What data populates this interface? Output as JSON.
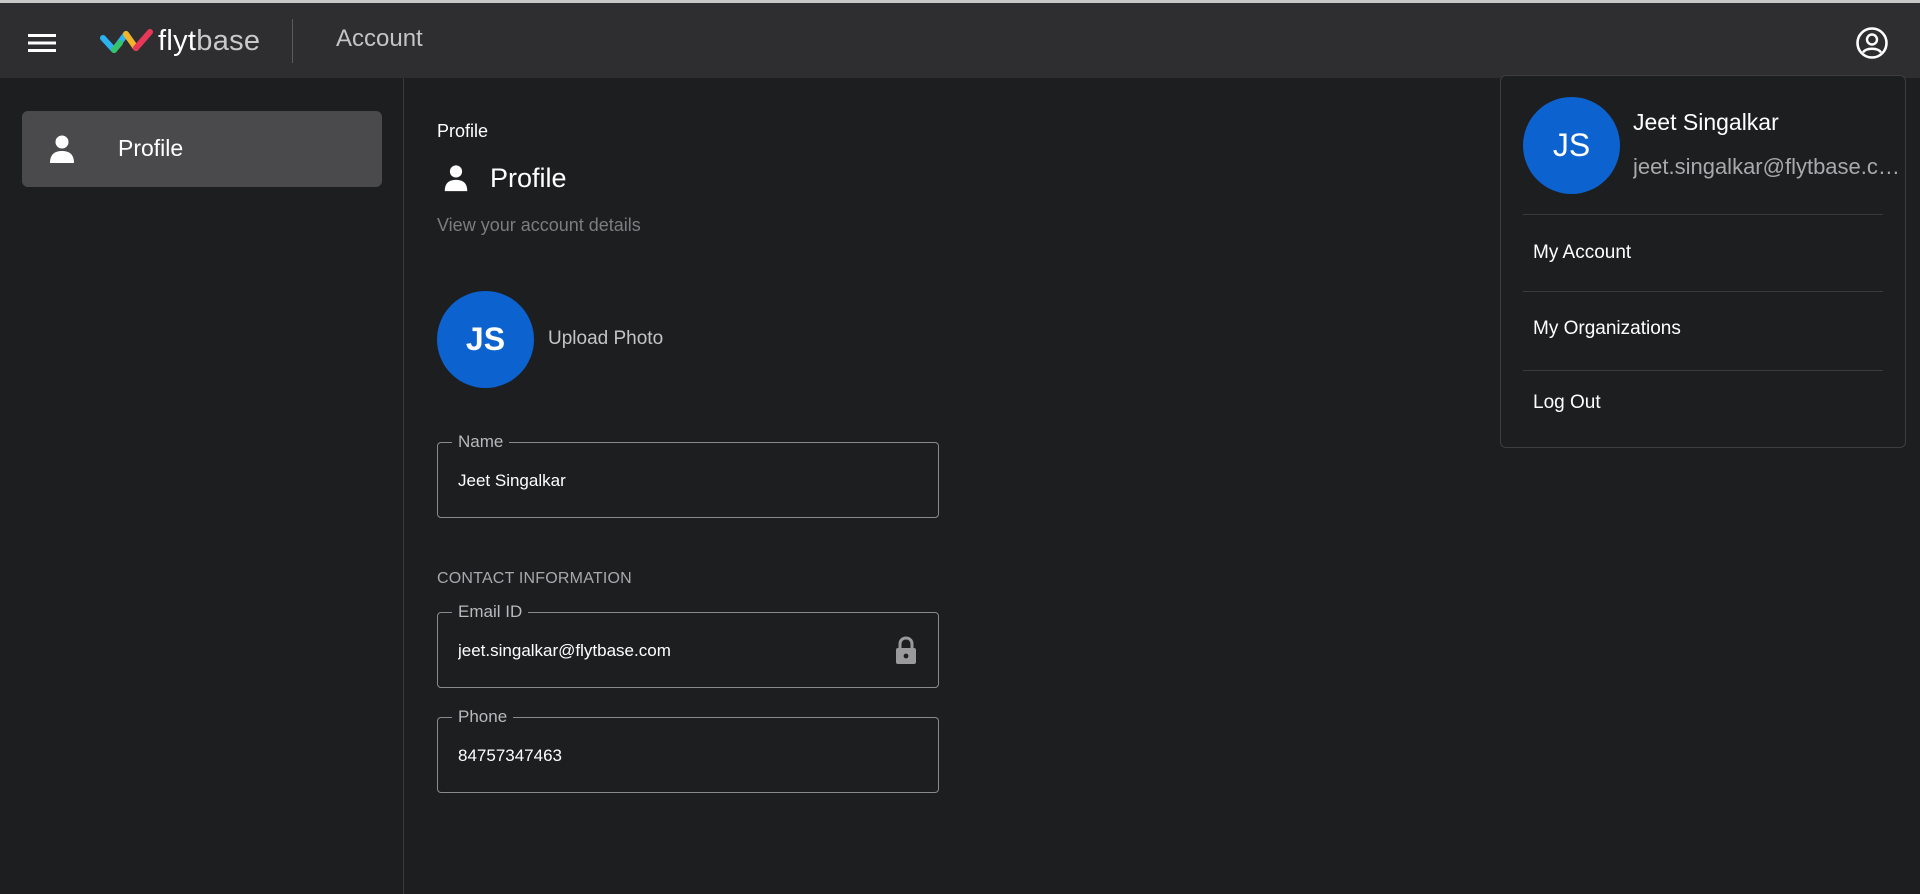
{
  "header": {
    "logo_fly": "flyt",
    "logo_base": "base",
    "title": "Account"
  },
  "sidebar": {
    "items": [
      {
        "label": "Profile",
        "icon": "person-icon"
      }
    ]
  },
  "main": {
    "breadcrumb": "Profile",
    "title": "Profile",
    "subtitle": "View your account details",
    "avatar_initials": "JS",
    "upload_label": "Upload Photo",
    "name_field": {
      "label": "Name",
      "value": "Jeet Singalkar"
    },
    "contact_section": "CONTACT INFORMATION",
    "email_field": {
      "label": "Email ID",
      "value": "jeet.singalkar@flytbase.com"
    },
    "phone_field": {
      "label": "Phone",
      "value": "84757347463"
    }
  },
  "account_menu": {
    "initials": "JS",
    "name": "Jeet Singalkar",
    "email": "jeet.singalkar@flytbase.com",
    "items": [
      "My Account",
      "My Organizations",
      "Log Out"
    ]
  },
  "colors": {
    "background": "#1d1e20",
    "header": "#2e2e30",
    "accent_avatar": "#0c62cf",
    "sidebar_active": "#4a4a4d"
  }
}
